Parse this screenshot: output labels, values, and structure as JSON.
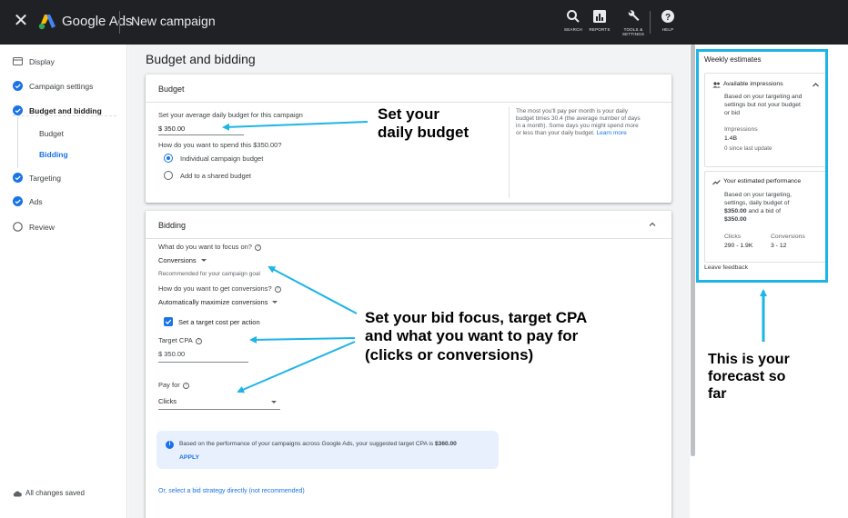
{
  "topbar": {
    "brand": "Google Ads",
    "page_title": "New campaign",
    "items": [
      {
        "label": "SEARCH",
        "icon": "search-icon"
      },
      {
        "label": "REPORTS",
        "icon": "reports-icon"
      },
      {
        "label": "TOOLS & SETTINGS",
        "icon": "wrench-icon"
      },
      {
        "label": "HELP",
        "icon": "help-icon"
      }
    ]
  },
  "sidebar": {
    "items": [
      {
        "label": "Display",
        "icon": "display-icon"
      },
      {
        "label": "Campaign settings",
        "icon": "check-circle-icon"
      },
      {
        "label": "Budget and bidding",
        "icon": "check-circle-icon"
      },
      {
        "label": "Budget"
      },
      {
        "label": "Bidding"
      },
      {
        "label": "Targeting",
        "icon": "check-circle-icon"
      },
      {
        "label": "Ads",
        "icon": "check-circle-icon"
      },
      {
        "label": "Review",
        "icon": "empty-circle-icon"
      }
    ],
    "saved_status": "All changes saved"
  },
  "main": {
    "title": "Budget and bidding",
    "budget": {
      "heading": "Budget",
      "prompt": "Set your average daily budget for this campaign",
      "value": "$ 350.00",
      "spend_question": "How do you want to spend this $350.00?",
      "option_individual": "Individual campaign budget",
      "option_shared": "Add to a shared budget",
      "info_lines": [
        "The most you'll pay per month is your daily",
        "budget times 30.4 (the average number of days",
        "in a month). Some days you might spend more"
      ],
      "info_last": "or less than your daily budget.",
      "learn_more": "Learn more"
    },
    "bidding": {
      "heading": "Bidding",
      "focus_question": "What do you want to focus on?",
      "focus_value": "Conversions",
      "recommended": "Recommended for your campaign goal",
      "get_conv_question": "How do you want to get conversions?",
      "get_conv_value": "Automatically maximize conversions",
      "target_checkbox": "Set a target cost per action",
      "target_cpa_label": "Target CPA",
      "target_cpa_value": "$ 350.00",
      "pay_for_label": "Pay for",
      "pay_for_value": "Clicks",
      "banner_text": "Based on the performance of your campaigns across Google Ads, your suggested target CPA is",
      "banner_value": "$360.00",
      "banner_apply": "APPLY",
      "strategy_link": "Or, select a bid strategy directly (not recommended)"
    }
  },
  "weekly": {
    "title": "Weekly estimates",
    "impressions_card": {
      "heading": "Available impressions",
      "desc_lines": [
        "Based on your targeting and",
        "settings but not your budget",
        "or bid"
      ],
      "metric_label": "Impressions",
      "metric_value": "1.4B",
      "since": "0 since last update"
    },
    "performance_card": {
      "heading": "Your estimated performance",
      "desc_lines": [
        "Based on your targeting,",
        "settings, daily budget of"
      ],
      "budget_bold": "$350.00",
      "and_bid": " and a bid of",
      "bid_bold": "$350.00",
      "clicks_label": "Clicks",
      "clicks_value": "290 - 1.9K",
      "conv_label": "Conversions",
      "conv_value": "3 - 12"
    },
    "feedback": "Leave feedback"
  },
  "annotations": {
    "budget_line1": "Set your",
    "budget_line2": "daily budget",
    "bid_line1": "Set your bid focus, target CPA",
    "bid_line2": "and what you want to pay for",
    "bid_line3": "(clicks or conversions)",
    "forecast_line1": "This is your",
    "forecast_line2": "forecast so",
    "forecast_line3": "far"
  },
  "colors": {
    "topbar": "#202124",
    "accent": "#1a73e8",
    "annotation_arrow": "#1eb4e6"
  }
}
